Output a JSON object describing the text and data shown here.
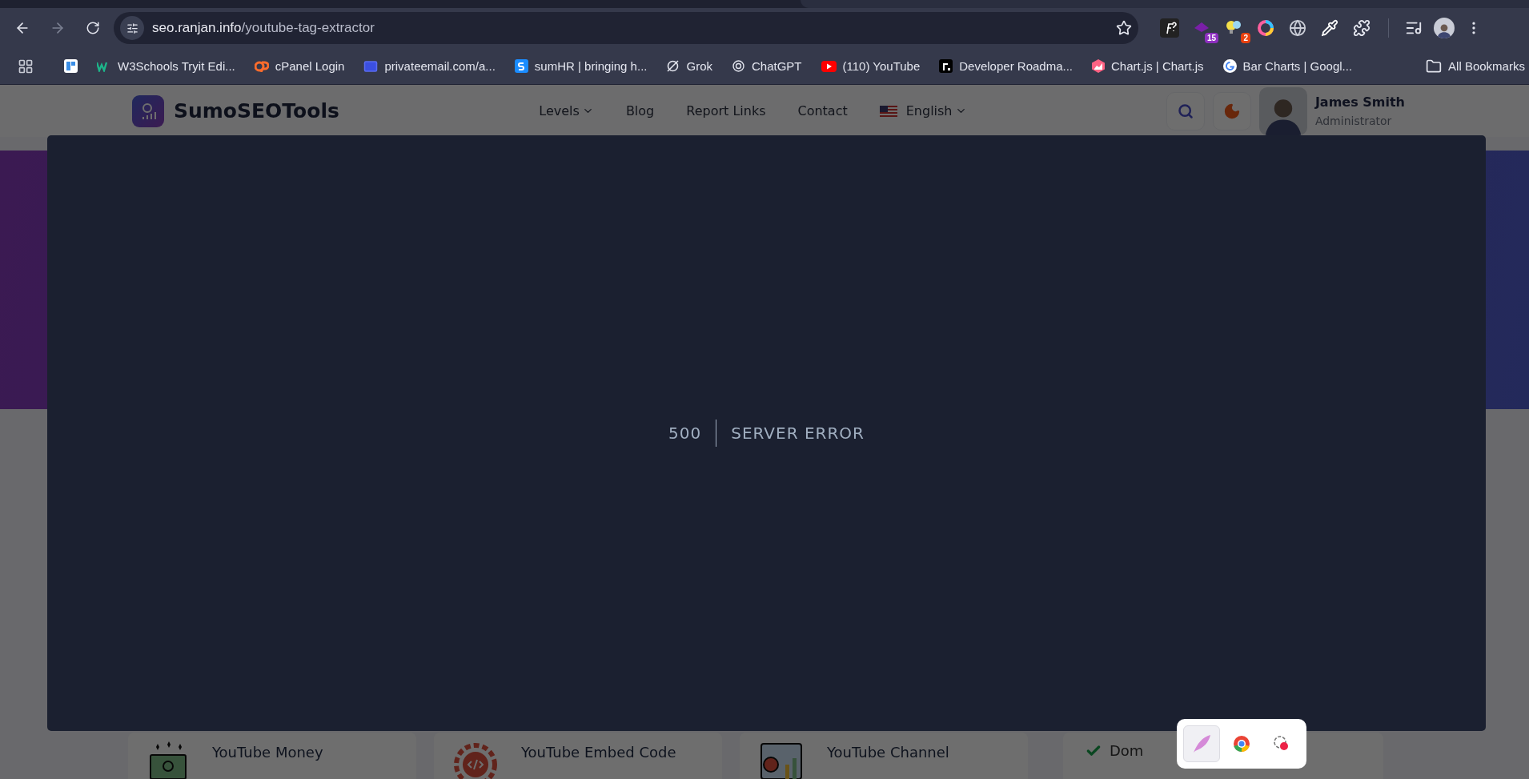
{
  "browser": {
    "url_domain": "seo.ranjan.info",
    "url_path": "/youtube-tag-extractor",
    "forward_disabled": true,
    "extensions": [
      {
        "kind": "font"
      },
      {
        "kind": "hat",
        "badge": "15",
        "color": "#8e2fc0"
      },
      {
        "kind": "bulbs",
        "badge": "2",
        "color": "#e8410f"
      },
      {
        "kind": "ring"
      },
      {
        "kind": "globe"
      },
      {
        "kind": "picker"
      },
      {
        "kind": "puzzle"
      }
    ],
    "bookmarks": [
      {
        "kind": "aw"
      },
      {
        "kind": "w3",
        "label": "W3Schools Tryit Edi..."
      },
      {
        "kind": "cpanel",
        "label": "cPanel Login"
      },
      {
        "kind": "mail",
        "label": "privateemail.com/a..."
      },
      {
        "kind": "s",
        "label": "sumHR | bringing h..."
      },
      {
        "kind": "grok",
        "label": "Grok"
      },
      {
        "kind": "gpt",
        "label": "ChatGPT"
      },
      {
        "kind": "youtube",
        "label": "(110) YouTube"
      },
      {
        "kind": "roadmap",
        "label": "Developer Roadma..."
      },
      {
        "kind": "chartjs",
        "label": "Chart.js | Chart.js"
      },
      {
        "kind": "google",
        "label": "Bar Charts  |  Googl..."
      }
    ],
    "all_bookmarks": "All Bookmarks"
  },
  "site": {
    "brand": "SumoSEOTools",
    "nav": [
      {
        "label": "Levels",
        "dropdown": true
      },
      {
        "label": "Blog",
        "dropdown": false
      },
      {
        "label": "Report Links",
        "dropdown": false
      },
      {
        "label": "Contact",
        "dropdown": false
      }
    ],
    "language": "English",
    "user_name": "James Smith",
    "user_role": "Administrator"
  },
  "modal": {
    "code": "500",
    "message": "SERVER ERROR"
  },
  "tools": [
    "YouTube Money",
    "YouTube Embed Code",
    "YouTube Channel"
  ],
  "side_item": {
    "label": "Dom",
    "checked": true
  },
  "tray": [
    {
      "kind": "feather",
      "selected": true
    },
    {
      "kind": "chrome",
      "selected": false
    },
    {
      "kind": "flower",
      "selected": false
    }
  ]
}
